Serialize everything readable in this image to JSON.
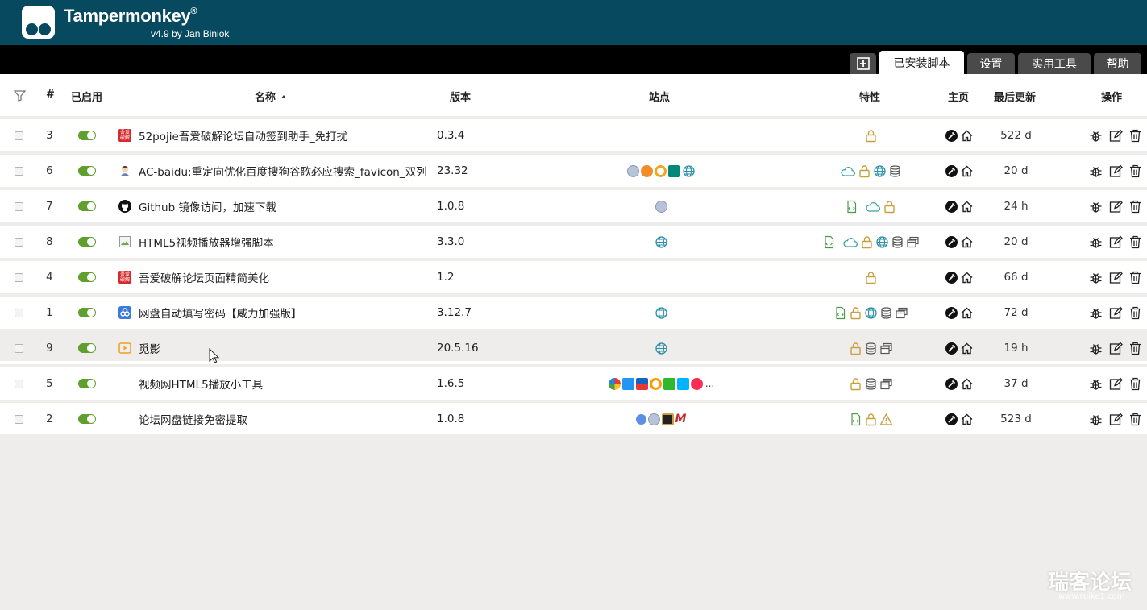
{
  "app": {
    "name": "Tampermonkey",
    "reg": "®",
    "version_line": "v4.9 by Jan Biniok"
  },
  "tabs": [
    {
      "label": ""
    },
    {
      "label": "已安装脚本"
    },
    {
      "label": "设置"
    },
    {
      "label": "实用工具"
    },
    {
      "label": "帮助"
    }
  ],
  "columns": {
    "num": "#",
    "enabled": "已启用",
    "name": "名称",
    "version": "版本",
    "sites": "站点",
    "features": "特性",
    "homepage": "主页",
    "updated": "最后更新",
    "actions": "操作"
  },
  "scripts": [
    {
      "num": "3",
      "name": "52pojie吾爱破解论坛自动签到助手_免打扰",
      "version": "0.3.4",
      "updated": "522 d",
      "favicon": "pojie"
    },
    {
      "num": "6",
      "name": "AC-baidu:重定向优化百度搜狗谷歌必应搜索_favicon_双列",
      "version": "23.32",
      "updated": "20 d",
      "favicon": "ac"
    },
    {
      "num": "7",
      "name": "Github 镜像访问，加速下载",
      "version": "1.0.8",
      "updated": "24 h",
      "favicon": "github"
    },
    {
      "num": "8",
      "name": "HTML5视频播放器增强脚本",
      "version": "3.3.0",
      "updated": "20 d",
      "favicon": "broken-image"
    },
    {
      "num": "4",
      "name": "吾爱破解论坛页面精简美化",
      "version": "1.2",
      "updated": "66 d",
      "favicon": "pojie"
    },
    {
      "num": "1",
      "name": "网盘自动填写密码【威力加强版】",
      "version": "3.12.7",
      "updated": "72 d",
      "favicon": "baidu-pan"
    },
    {
      "num": "9",
      "name": "觅影",
      "version": "20.5.16",
      "updated": "19 h",
      "favicon": "play"
    },
    {
      "num": "5",
      "name": "视频网HTML5播放小工具",
      "version": "1.6.5",
      "updated": "37 d",
      "favicon": ""
    },
    {
      "num": "2",
      "name": "论坛网盘链接免密提取",
      "version": "1.0.8",
      "updated": "523 d",
      "favicon": ""
    }
  ],
  "site_ellipsis": "...",
  "watermark": {
    "text": "瑞客论坛",
    "url": "www.ruike1.com"
  },
  "colors": {
    "header": "#074a5f",
    "toggle_on": "#5e9f2d",
    "lock": "#c8a040",
    "cloud": "#3aa0a0",
    "globe": "#2a8fa8"
  }
}
